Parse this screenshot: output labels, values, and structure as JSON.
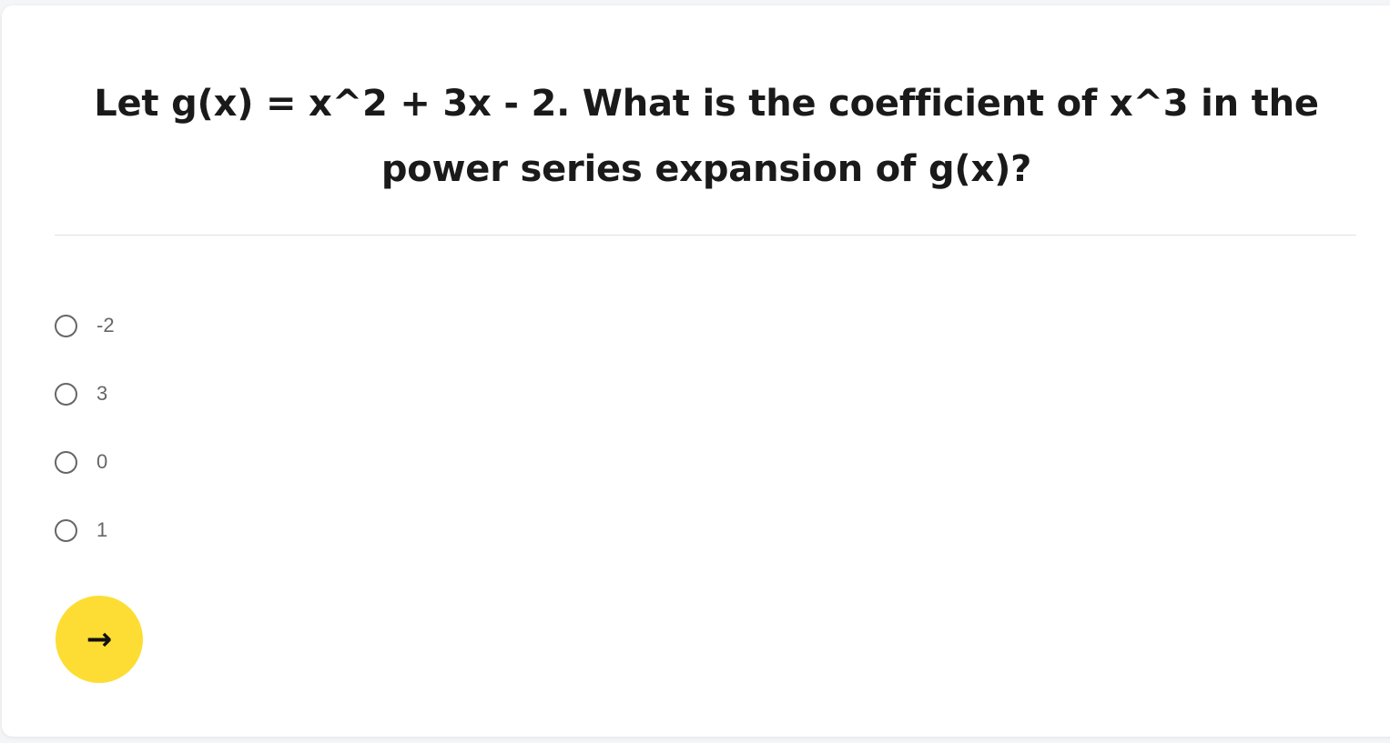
{
  "question": {
    "text": "Let g(x) = x^2 + 3x - 2. What is the coefficient of x^3 in the power series expansion of g(x)?"
  },
  "options": [
    {
      "label": "-2",
      "selected": false
    },
    {
      "label": "3",
      "selected": false
    },
    {
      "label": "0",
      "selected": false
    },
    {
      "label": "1",
      "selected": false
    }
  ],
  "next_button": {
    "icon": "→",
    "icon_name": "arrow-right-icon",
    "color": "#fddd33"
  }
}
